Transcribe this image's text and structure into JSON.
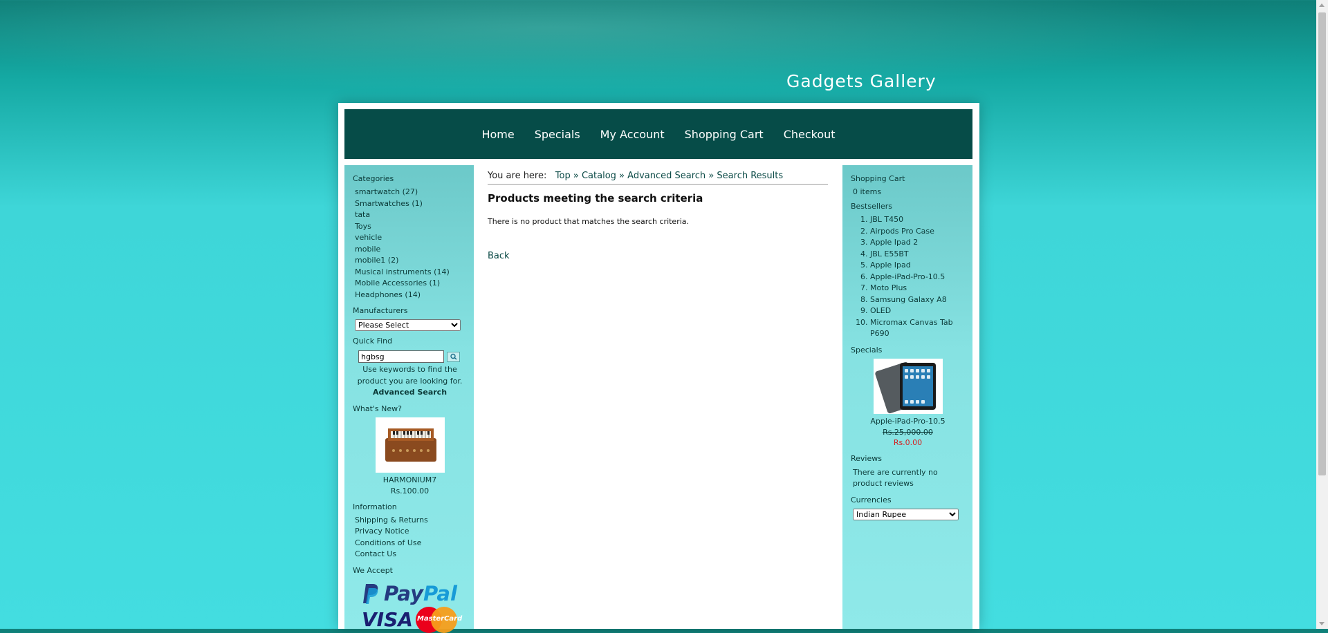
{
  "site": {
    "title": "Gadgets Gallery"
  },
  "nav": {
    "items": [
      "Home",
      "Specials",
      "My Account",
      "Shopping Cart",
      "Checkout"
    ]
  },
  "left": {
    "categories_title": "Categories",
    "categories": [
      "smartwatch (27)",
      "Smartwatches (1)",
      "tata",
      "Toys",
      "vehicle",
      "mobile",
      "mobile1 (2)",
      "Musical instruments (14)",
      "Mobile Accessories (1)",
      "Headphones (14)"
    ],
    "manufacturers_title": "Manufacturers",
    "manufacturers_selected": "Please Select",
    "quickfind_title": "Quick Find",
    "quickfind_value": "hgbsg",
    "quickfind_help": "Use keywords to find the product you are looking for.",
    "advanced_search": "Advanced Search",
    "whatsnew_title": "What's New?",
    "whatsnew_product": "HARMONIUM7",
    "whatsnew_price": "Rs.100.00",
    "information_title": "Information",
    "information_links": [
      "Shipping & Returns",
      "Privacy Notice",
      "Conditions of Use",
      "Contact Us"
    ],
    "weaccept_title": "We Accept",
    "paypal_pay": "Pay",
    "paypal_pal": "Pal",
    "visa": "VISA",
    "mastercard": "MasterCard"
  },
  "main": {
    "crumb_label": "You are here:",
    "breadcrumb": [
      "Top",
      "Catalog",
      "Advanced Search",
      "Search Results"
    ],
    "breadcrumb_sep": "»",
    "heading": "Products meeting the search criteria",
    "message": "There is no product that matches the search criteria.",
    "back": "Back"
  },
  "right": {
    "cart_title": "Shopping Cart",
    "cart_items": "0 items",
    "bestsellers_title": "Bestsellers",
    "bestsellers": [
      "JBL T450",
      "Airpods Pro Case",
      "Apple Ipad 2",
      "JBL E55BT",
      "Apple Ipad",
      "Apple-iPad-Pro-10.5",
      "Moto Plus",
      "Samsung Galaxy A8",
      "OLED",
      "Micromax Canvas Tab P690"
    ],
    "specials_title": "Specials",
    "specials_product": "Apple-iPad-Pro-10.5",
    "specials_old_price": "Rs.25,000.00",
    "specials_new_price": "Rs.0.00",
    "reviews_title": "Reviews",
    "reviews_text": "There are currently no product reviews",
    "currencies_title": "Currencies",
    "currency_selected": "Indian Rupee"
  },
  "colors": {
    "nav_bg": "#064c48",
    "price_special": "#d42020",
    "link": "#0b4a46"
  }
}
